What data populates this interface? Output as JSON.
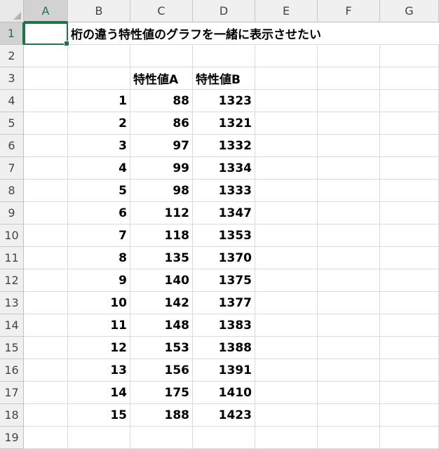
{
  "sheet": {
    "columns": [
      "A",
      "B",
      "C",
      "D",
      "E",
      "F",
      "G"
    ],
    "rows": [
      "1",
      "2",
      "3",
      "4",
      "5",
      "6",
      "7",
      "8",
      "9",
      "10",
      "11",
      "12",
      "13",
      "14",
      "15",
      "16",
      "17",
      "18",
      "19"
    ],
    "selected_cell": "A1",
    "accent_color": "#217346",
    "title": "桁の違う特性値のグラフを一緒に表示させたい",
    "header_a": "特性値A",
    "header_b": "特性値B",
    "data": [
      {
        "n": "1",
        "a": "88",
        "b": "1323"
      },
      {
        "n": "2",
        "a": "86",
        "b": "1321"
      },
      {
        "n": "3",
        "a": "97",
        "b": "1332"
      },
      {
        "n": "4",
        "a": "99",
        "b": "1334"
      },
      {
        "n": "5",
        "a": "98",
        "b": "1333"
      },
      {
        "n": "6",
        "a": "112",
        "b": "1347"
      },
      {
        "n": "7",
        "a": "118",
        "b": "1353"
      },
      {
        "n": "8",
        "a": "135",
        "b": "1370"
      },
      {
        "n": "9",
        "a": "140",
        "b": "1375"
      },
      {
        "n": "10",
        "a": "142",
        "b": "1377"
      },
      {
        "n": "11",
        "a": "148",
        "b": "1383"
      },
      {
        "n": "12",
        "a": "153",
        "b": "1388"
      },
      {
        "n": "13",
        "a": "156",
        "b": "1391"
      },
      {
        "n": "14",
        "a": "175",
        "b": "1410"
      },
      {
        "n": "15",
        "a": "188",
        "b": "1423"
      }
    ]
  }
}
